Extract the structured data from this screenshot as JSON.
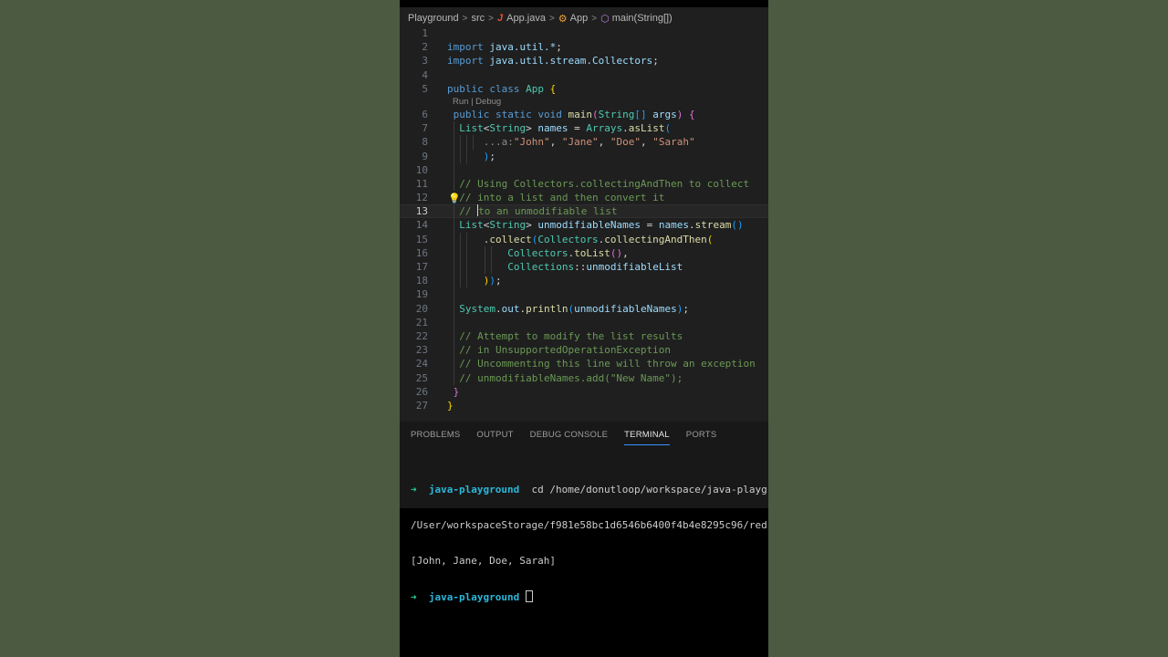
{
  "breadcrumb": {
    "items": [
      "Playground",
      "src",
      "App.java",
      "App",
      "main(String[])"
    ],
    "icons": [
      "java-file-icon",
      "class-icon",
      "method-icon"
    ]
  },
  "editor": {
    "current_line": 13,
    "codelens": "Run | Debug",
    "lines": [
      {
        "n": "1"
      },
      {
        "n": "2"
      },
      {
        "n": "3"
      },
      {
        "n": "4"
      },
      {
        "n": "5"
      },
      {
        "n": "6"
      },
      {
        "n": "7"
      },
      {
        "n": "8"
      },
      {
        "n": "9"
      },
      {
        "n": "10"
      },
      {
        "n": "11"
      },
      {
        "n": "12"
      },
      {
        "n": "13"
      },
      {
        "n": "14"
      },
      {
        "n": "15"
      },
      {
        "n": "16"
      },
      {
        "n": "17"
      },
      {
        "n": "18"
      },
      {
        "n": "19"
      },
      {
        "n": "20"
      },
      {
        "n": "21"
      },
      {
        "n": "22"
      },
      {
        "n": "23"
      },
      {
        "n": "24"
      },
      {
        "n": "25"
      },
      {
        "n": "26"
      },
      {
        "n": "27"
      }
    ],
    "code": {
      "l2_import": "import",
      "l2_pkg": "java.util.*",
      "l3_import": "import",
      "l3_pkg": "java.util.stream.Collectors",
      "l5_public": "public",
      "l5_class": "class",
      "l5_name": "App",
      "l6_public": "public",
      "l6_static": "static",
      "l6_void": "void",
      "l6_main": "main",
      "l6_type": "String",
      "l6_args": "args",
      "l7_list": "List",
      "l7_string": "String",
      "l7_names": "names",
      "l7_arrays": "Arrays",
      "l7_aslist": "asList",
      "l8_hint": "...a:",
      "l8_s1": "\"John\"",
      "l8_s2": "\"Jane\"",
      "l8_s3": "\"Doe\"",
      "l8_s4": "\"Sarah\"",
      "l11": "// Using Collectors.collectingAndThen to collect",
      "l12": "// into a list and then convert it",
      "l13a": "// ",
      "l13b": "to an unmodifiable list",
      "l14_list": "List",
      "l14_string": "String",
      "l14_var": "unmodifiableNames",
      "l14_names": "names",
      "l14_stream": "stream",
      "l15_collect": "collect",
      "l15_collectors": "Collectors",
      "l15_cat": "collectingAndThen",
      "l16_collectors": "Collectors",
      "l16_tolist": "toList",
      "l17_collections": "Collections",
      "l17_method": "unmodifiableList",
      "l20_system": "System",
      "l20_out": "out",
      "l20_println": "println",
      "l20_arg": "unmodifiableNames",
      "l22": "// Attempt to modify the list results",
      "l23": "// in UnsupportedOperationException",
      "l24": "// Uncommenting this line will throw an exception",
      "l25": "// unmodifiableNames.add(\"New Name\");"
    }
  },
  "panel": {
    "tabs": [
      "PROBLEMS",
      "OUTPUT",
      "DEBUG CONSOLE",
      "TERMINAL",
      "PORTS"
    ],
    "active_tab": "TERMINAL"
  },
  "terminal": {
    "prompt_symbol": "➜",
    "dir": "java-playground",
    "command": "cd /home/donutloop/workspace/java-playg",
    "line2": "/User/workspaceStorage/f981e58bc1d6546b6400f4b4e8295c96/red",
    "output": "[John, Jane, Doe, Sarah]"
  },
  "colors": {
    "background": "#4b5a40",
    "editor_bg": "#1f1f1f",
    "panel_bg": "#181818",
    "accent": "#3794ff"
  }
}
